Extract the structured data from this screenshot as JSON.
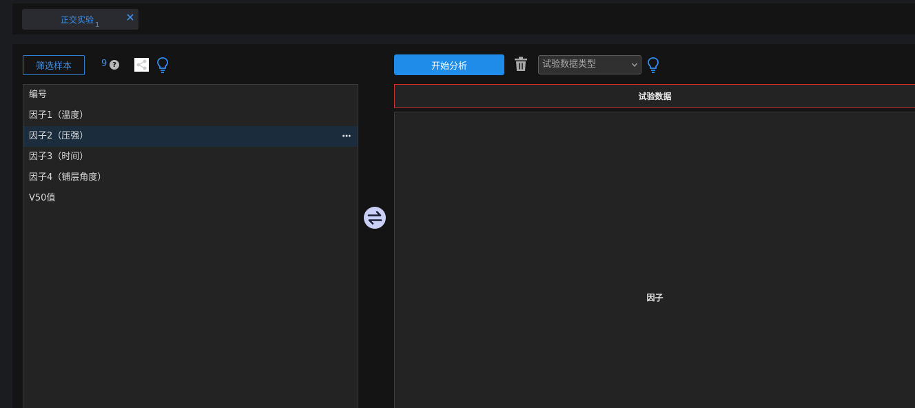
{
  "tab": {
    "title": "正交实验",
    "sub": "1"
  },
  "toolbar_left": {
    "filter_label": "筛选样本",
    "count": "9",
    "help_glyph": "?"
  },
  "variables": [
    {
      "label": "编号"
    },
    {
      "label": "因子1（温度）"
    },
    {
      "label": "因子2（压强）",
      "selected": true,
      "more": "···"
    },
    {
      "label": "因子3（时间）"
    },
    {
      "label": "因子4（铺层角度）"
    },
    {
      "label": "V50值"
    }
  ],
  "toolbar_right": {
    "start_label": "开始分析",
    "select_placeholder": "试验数据类型"
  },
  "panels": {
    "data_header": "试验数据",
    "factor_label": "因子"
  },
  "colors": {
    "accent": "#1f8cea",
    "header_border": "#d02e2e"
  },
  "icons": {
    "tab_close": "close-icon",
    "help": "help-icon",
    "share": "share-icon",
    "bulb": "lightbulb-icon",
    "swap": "swap-icon",
    "trash": "trash-icon",
    "more": "more-icon"
  }
}
